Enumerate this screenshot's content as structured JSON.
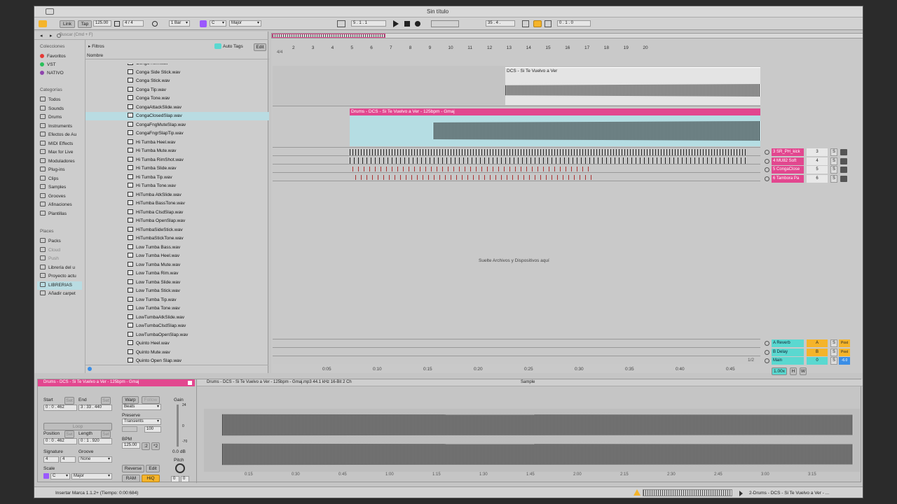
{
  "window": {
    "title": "Sin título"
  },
  "transport": {
    "link": "Link",
    "tap": "Tap",
    "tempo": "125.00",
    "time_sig": "4 / 4",
    "quantize": "1 Bar",
    "key": "C",
    "scale": "Major",
    "position": "5 . 1 . 1",
    "loop_start": "35 . 4 .",
    "loop_length": "0 . 1 . 0"
  },
  "browser": {
    "search_placeholder": "Buscar (Cmd + F)",
    "collections_header": "Colecciones",
    "collections": [
      {
        "label": "Favoritos",
        "color": "#e53935"
      },
      {
        "label": "VST",
        "color": "#2bbf5a"
      },
      {
        "label": "NATIVO",
        "color": "#8e44ad"
      }
    ],
    "categories_header": "Categorías",
    "categories": [
      "Todos",
      "Sounds",
      "Drums",
      "Instruments",
      "Efectos de Au",
      "MIDI Effects",
      "Max for Live",
      "Moduladores",
      "Plug-ins",
      "Clips",
      "Samples",
      "Grooves",
      "Afinaciones",
      "Plantillas"
    ],
    "places_header": "Places",
    "places": [
      "Packs",
      "Cloud",
      "Push",
      "Librería del u",
      "Proyecto actu",
      "LIBRERIAS",
      "Añadir carpet"
    ],
    "places_selected": "LIBRERIAS",
    "filters_label": "Filtros",
    "auto_tags_label": "Auto Tags",
    "edit_label": "Edit",
    "name_column": "Nombre",
    "files": [
      "Conga Rim.wav",
      "Conga Side Stick.wav",
      "Conga Stick.wav",
      "Conga Tip.wav",
      "Conga Tone.wav",
      "CongaAttackSlide.wav",
      "CongaClosedSlap.wav",
      "CongaFngMuteSlap.wav",
      "CongaFngrSlapTip.wav",
      "Hi Tumba Heel.wav",
      "Hi Tumba Mute.wav",
      "Hi Tumba RimShot.wav",
      "Hi Tumba Slide.wav",
      "Hi Tumba Tip.wav",
      "Hi Tumba Tone.wav",
      "HiTumba AtkSlide.wav",
      "HiTumba BassTone.wav",
      "HiTumba ClsdSlap.wav",
      "HiTumba OpenSlap.wav",
      "HiTumbaSideStick.wav",
      "HiTumbaStickTone.wav",
      "Low Tumba Bass.wav",
      "Low Tumba Heel.wav",
      "Low Tumba Mute.wav",
      "Low Tumba Rim.wav",
      "Low Tumba Slide.wav",
      "Low Tumba Stick.wav",
      "Low Tumba Tip.wav",
      "Low Tumba Tone.wav",
      "LowTumbaAtkSlide.wav",
      "LowTumbaClsdSlap.wav",
      "LowTumbaOpenSlap.wav",
      "Quinto Heel.wav",
      "Quinto Mute.wav",
      "Quinto Open Slap.wav"
    ],
    "selected_file": "CongaClosedSlap.wav"
  },
  "arrangement": {
    "ruler": [
      "2",
      "3",
      "4",
      "5",
      "6",
      "7",
      "8",
      "9",
      "10",
      "11",
      "12",
      "13",
      "14",
      "15",
      "16",
      "17",
      "18",
      "19",
      "20"
    ],
    "sig_marker": "4/4",
    "clip1_name": "DCS - Si Te Vuelvo a Ver",
    "clip2_name": "Drums - DCS - Si Te Vuelvo a Ver - 125bpm - Gmaj",
    "drop_hint": "Suelte Archivos y Dispositivos aquí",
    "time_ruler": [
      "0:05",
      "0:10",
      "0:15",
      "0:20",
      "0:25",
      "0:30",
      "0:35",
      "0:40",
      "0:45"
    ],
    "page": "1/2",
    "zoom": "1.00x"
  },
  "mixer": {
    "tracks": [
      {
        "name": "3 SR_PH_kick",
        "num": "3",
        "color": "#e2478f"
      },
      {
        "name": "4 MU82 Soft",
        "num": "4",
        "color": "#e2478f"
      },
      {
        "name": "5 CongaClose",
        "num": "5",
        "color": "#e2478f"
      },
      {
        "name": "6 Tambora Pa",
        "num": "6",
        "color": "#e2478f"
      }
    ],
    "returns": [
      {
        "name": "A Reverb",
        "num": "A",
        "color": "#5ad8d0"
      },
      {
        "name": "B Delay",
        "num": "B",
        "color": "#5ad8d0"
      },
      {
        "name": "Main",
        "num": "0",
        "color": "#5ad8d0"
      }
    ],
    "solo_label": "S",
    "post_label": "Post",
    "h_label": "H",
    "w_label": "W",
    "main_value": "-6.0"
  },
  "clip_view": {
    "title": "Drums - DCS - Si Te Vuelvo a Ver - 125bpm - Gmaj",
    "file_info": "Drums - DCS - Si Te Vuelvo a Ver - 125bpm - Gmaj.mp3  44.1 kHz  16-Bit  2 Ch",
    "sample_tab": "Sample",
    "start_label": "Start",
    "end_label": "End",
    "set_label": "Set",
    "start_value": "0 : 0 . 462",
    "end_value": "3 : 33 . 440",
    "loop_label": "Loop",
    "position_label": "Position",
    "length_label": "Length",
    "position_value": "0 : 0 . 462",
    "length_value": "0 : 1 . 920",
    "signature_label": "Signature",
    "groove_label": "Groove",
    "sig_num": "4",
    "sig_den": "4",
    "groove_value": "None",
    "scale_label": "Scale",
    "scale_key": "C",
    "scale_mode": "Major",
    "warp_label": "Warp",
    "follow_label": "Follow",
    "warp_mode": "Beats",
    "preserve_label": "Preserve",
    "preserve_value": "Transients",
    "grain_value": "100",
    "bpm_label": "BPM",
    "bpm_value": "125.00",
    "half_label": ":2",
    "double_label": "*2",
    "reverse_label": "Reverse",
    "edit_label": "Edit",
    "ram_label": "RAM",
    "hiq_label": "HiQ",
    "gain_label": "Gain",
    "gain_value": "0.0 dB",
    "gain_top": "24",
    "gain_mid": "0",
    "gain_bottom": "-70",
    "pitch_label": "Pitch",
    "pitch_value": "0",
    "pitch_fine": "0",
    "time_ruler": [
      "0:15",
      "0:30",
      "0:45",
      "1:00",
      "1:15",
      "1:30",
      "1:45",
      "2:00",
      "2:15",
      "2:30",
      "2:45",
      "3:00",
      "3:15"
    ]
  },
  "status": {
    "message": "Insertar Marca 1.1.2+ (Tiempo: 0:00:684)",
    "track_label": "2-Drums - DCS - Si Te Vuelvo a Ver - ..."
  }
}
